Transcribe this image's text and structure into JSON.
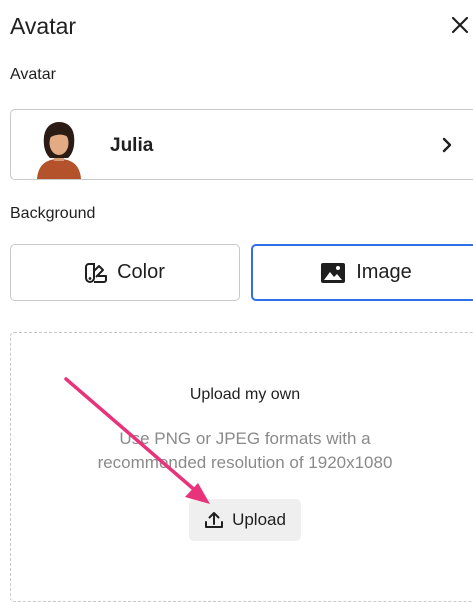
{
  "panel": {
    "title": "Avatar"
  },
  "avatar_section": {
    "label": "Avatar",
    "selected_name": "Julia"
  },
  "background_section": {
    "label": "Background",
    "tabs": [
      {
        "label": "Color"
      },
      {
        "label": "Image"
      }
    ],
    "active_tab": "Image"
  },
  "upload": {
    "title": "Upload my own",
    "description_line1": "Use PNG or JPEG formats with a",
    "description_line2": "recommended resolution of 1920x1080",
    "button_label": "Upload"
  },
  "colors": {
    "accent_border": "#2f6fe8",
    "annotation_arrow": "#e8327a",
    "muted_text": "#8a8a8a"
  },
  "icons": [
    "close-icon",
    "chevron-right-icon",
    "palette-icon",
    "image-icon",
    "upload-icon"
  ]
}
